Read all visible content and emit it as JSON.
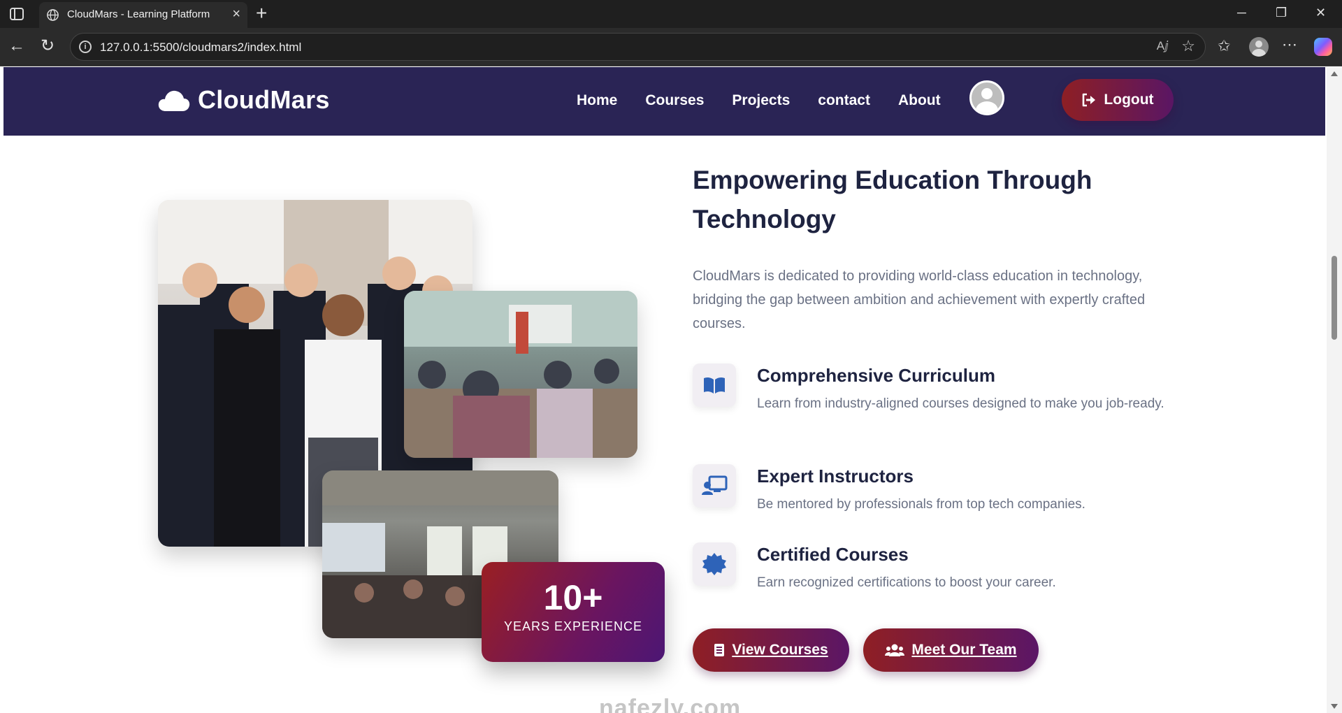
{
  "browser": {
    "tab_title": "CloudMars - Learning Platform",
    "url": "127.0.0.1:5500/cloudmars2/index.html",
    "new_tab": "+",
    "read_aloud": "Aⅉ"
  },
  "nav": {
    "brand": "CloudMars",
    "links": [
      "Home",
      "Courses",
      "Projects",
      "contact",
      "About"
    ],
    "logout_label": "Logout"
  },
  "hero": {
    "headline": "Empowering Education Through Technology",
    "intro": "CloudMars is dedicated to providing world-class education in technology, bridging the gap between ambition and achievement with expertly crafted courses.",
    "experience_number": "10+",
    "experience_label": "YEARS EXPERIENCE"
  },
  "features": [
    {
      "icon": "book-open-icon",
      "title": "Comprehensive Curriculum",
      "description": "Learn from industry-aligned courses designed to make you job-ready."
    },
    {
      "icon": "chalkboard-teacher-icon",
      "title": "Expert Instructors",
      "description": "Be mentored by professionals from top tech companies."
    },
    {
      "icon": "certificate-icon",
      "title": "Certified Courses",
      "description": "Earn recognized certifications to boost your career."
    }
  ],
  "buttons": {
    "view_courses": "View Courses",
    "meet_team": "Meet Our Team"
  },
  "watermark": "nafezly.com",
  "colors": {
    "nav_bg": "#2a2455",
    "accent_start": "#8f1f24",
    "accent_end": "#5b1666",
    "heading": "#1e2340",
    "body_text": "#6a7184",
    "icon_blue": "#2e63b8"
  }
}
